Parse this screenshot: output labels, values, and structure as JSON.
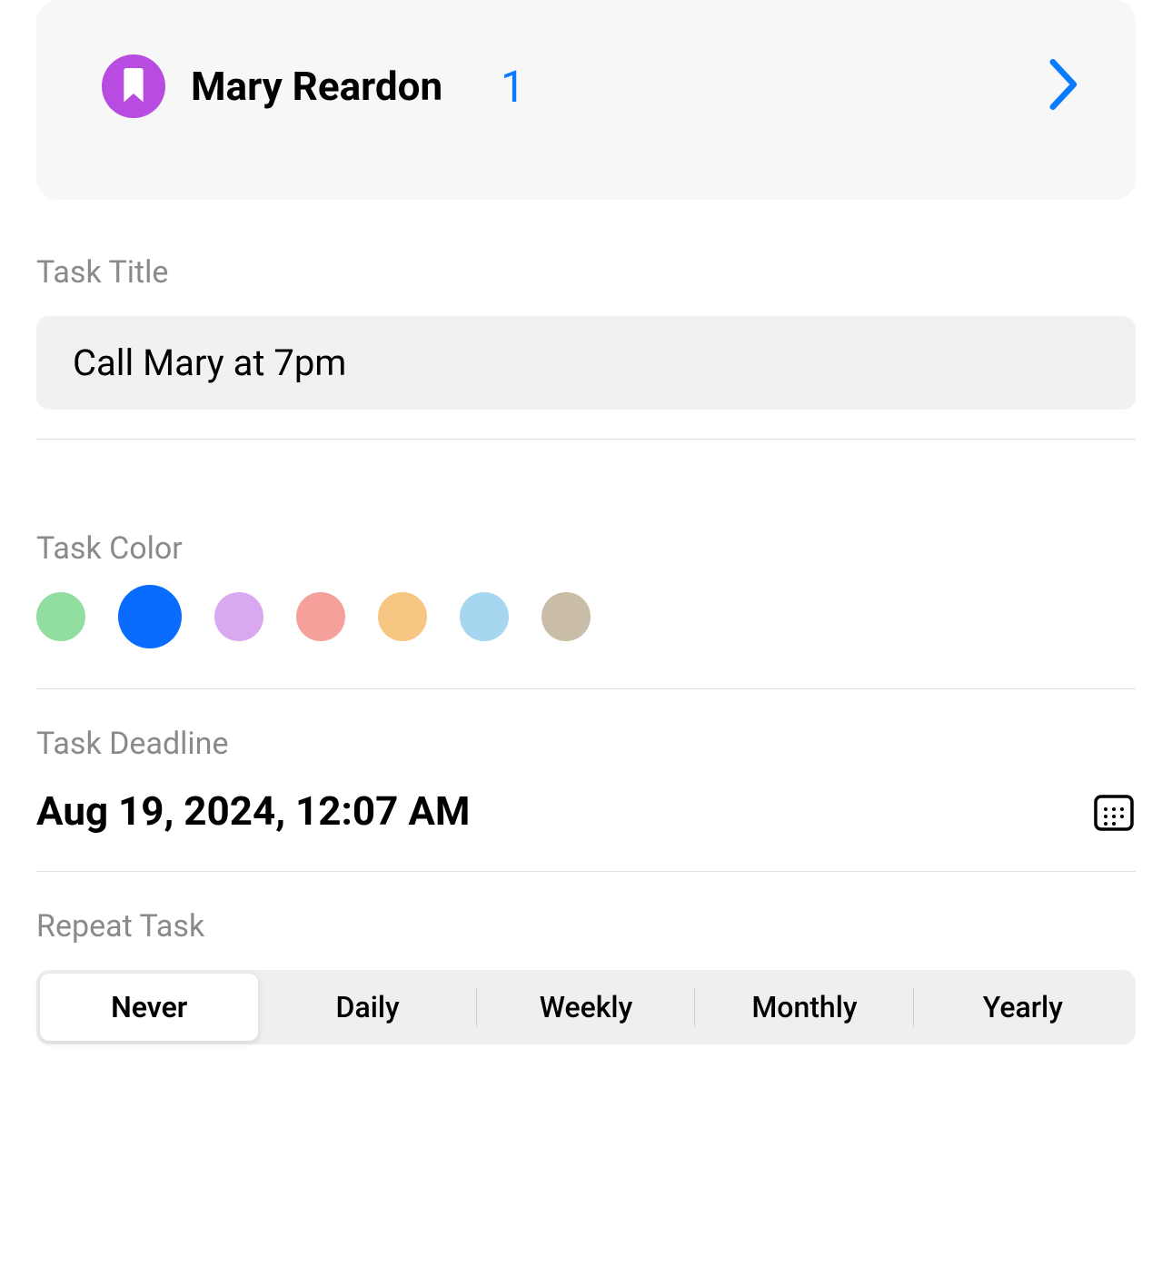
{
  "contact": {
    "name": "Mary Reardon",
    "count": "1",
    "badge_color": "#b84be0"
  },
  "labels": {
    "task_title": "Task Title",
    "task_color": "Task Color",
    "task_deadline": "Task Deadline",
    "repeat_task": "Repeat Task"
  },
  "task": {
    "title_value": "Call Mary at 7pm",
    "deadline": "Aug 19, 2024, 12:07 AM"
  },
  "colors": [
    {
      "hex": "#92dea1",
      "name": "green",
      "selected": false
    },
    {
      "hex": "#0a6cff",
      "name": "blue",
      "selected": true
    },
    {
      "hex": "#d9a8f0",
      "name": "purple",
      "selected": false
    },
    {
      "hex": "#f5a09a",
      "name": "coral",
      "selected": false
    },
    {
      "hex": "#f6c682",
      "name": "orange",
      "selected": false
    },
    {
      "hex": "#a6d6f0",
      "name": "light-blue",
      "selected": false
    },
    {
      "hex": "#c9bda8",
      "name": "tan",
      "selected": false
    }
  ],
  "repeat_options": [
    {
      "label": "Never",
      "selected": true
    },
    {
      "label": "Daily",
      "selected": false
    },
    {
      "label": "Weekly",
      "selected": false
    },
    {
      "label": "Monthly",
      "selected": false
    },
    {
      "label": "Yearly",
      "selected": false
    }
  ]
}
